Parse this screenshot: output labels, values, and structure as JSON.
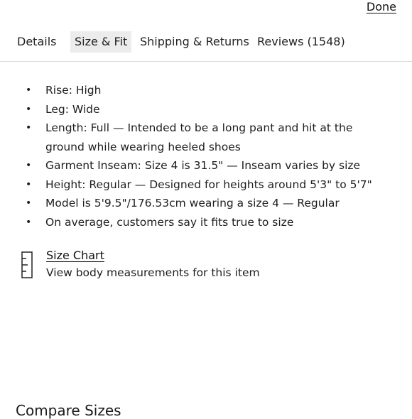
{
  "header": {
    "done_label": "Done"
  },
  "tabs": [
    {
      "label": "Details",
      "active": false
    },
    {
      "label": "Size & Fit",
      "active": true
    },
    {
      "label": "Shipping & Returns",
      "active": false
    },
    {
      "label": "Reviews (1548)",
      "active": false
    }
  ],
  "fit_details": [
    "Rise: High",
    "Leg: Wide",
    "Length: Full — Intended to be a long pant and hit at the ground while wearing heeled shoes",
    "Garment Inseam: Size 4 is 31.5\" — Inseam varies by size",
    "Height: Regular — Designed for heights around 5'3\" to 5'7\"",
    "Model is 5'9.5\"/176.53cm wearing a size 4  —  Regular",
    "On average, customers say it fits true to size"
  ],
  "size_chart": {
    "icon": "ruler-icon",
    "title": "Size Chart",
    "subtitle": "View body measurements for this item"
  },
  "compare_sizes": {
    "heading": "Compare Sizes"
  },
  "colors": {
    "active_tab_bg": "#ececec",
    "divider": "#d9d9d9",
    "text": "#1a1a1a"
  }
}
